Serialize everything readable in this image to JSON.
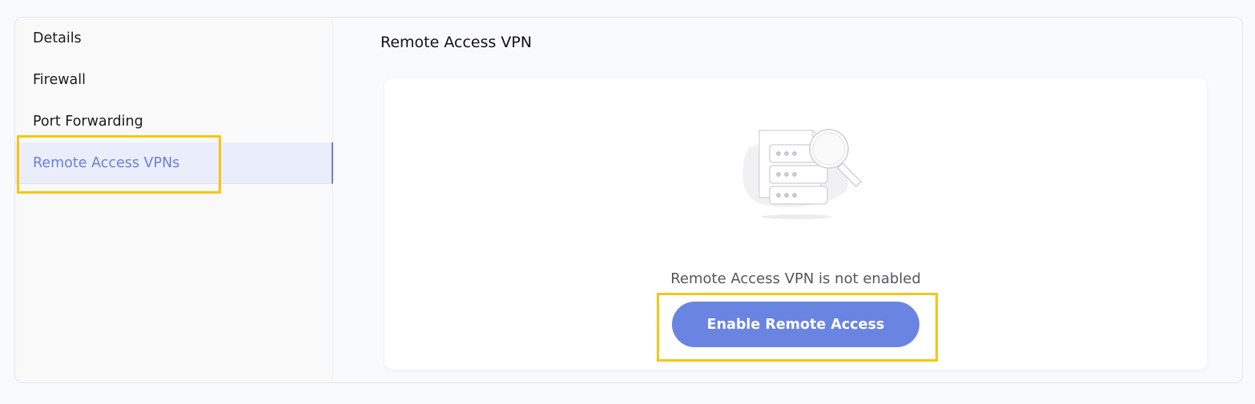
{
  "sidebar": {
    "items": [
      {
        "label": "Details"
      },
      {
        "label": "Firewall"
      },
      {
        "label": "Port Forwarding"
      },
      {
        "label": "Remote Access VPNs",
        "active": true
      }
    ]
  },
  "main": {
    "title": "Remote Access VPN",
    "empty_state": {
      "message": "Remote Access VPN is not enabled",
      "illustration_icon": "server-search-icon",
      "button_label": "Enable Remote Access"
    }
  },
  "colors": {
    "accent": "#6a84e2",
    "active_text": "#6a7fd6",
    "active_bg": "#eaeefa",
    "highlight": "#f6c516"
  }
}
